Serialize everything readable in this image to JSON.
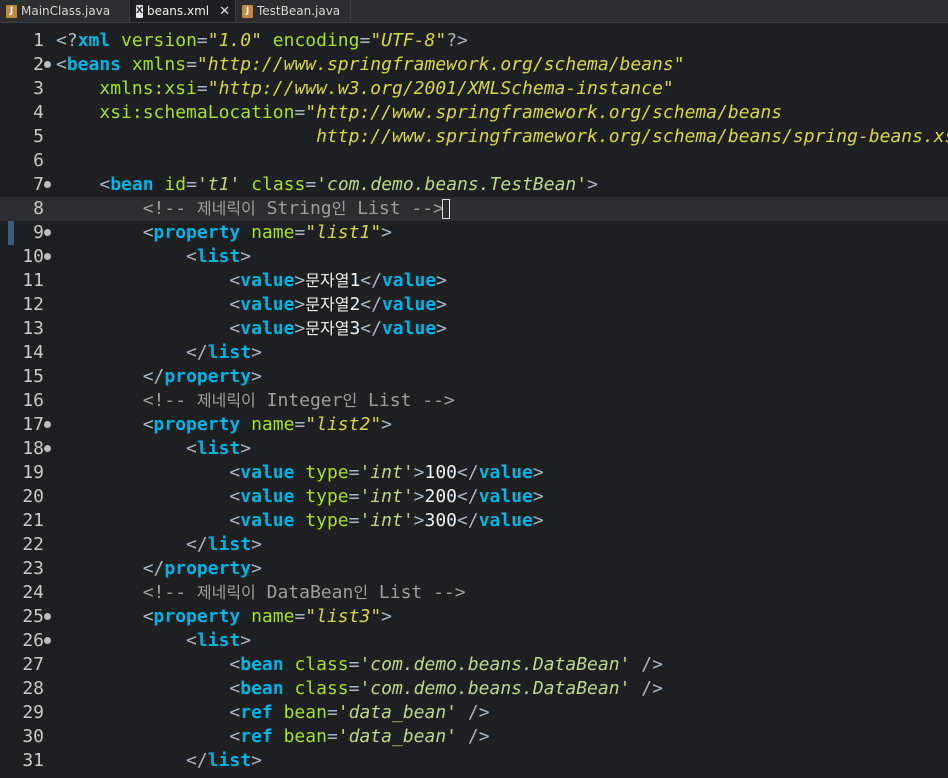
{
  "tabs": [
    {
      "label": "MainClass.java",
      "icon": "java-file-icon"
    },
    {
      "label": "beans.xml",
      "icon": "xml-file-icon",
      "active": true
    },
    {
      "label": "TestBean.java",
      "icon": "java-file-icon"
    }
  ],
  "lines": [
    {
      "n": "1",
      "html": "<span class='punct'>&lt;?</span><span class='tagn'>xml</span> <span class='attr'>version</span><span class='punct'>=</span><span class='str'>\"1.0\"</span> <span class='attr'>encoding</span><span class='punct'>=</span><span class='str'>\"UTF-8\"</span><span class='punct'>?&gt;</span>"
    },
    {
      "n": "2",
      "fold": true,
      "html": "<span class='punct'>&lt;</span><span class='tagn'>beans</span> <span class='attr'>xmlns</span><span class='punct'>=</span><span class='str'>\"http://www.springframework.org/schema/beans\"</span>"
    },
    {
      "n": "3",
      "html": "    <span class='attr'>xmlns:xsi</span><span class='punct'>=</span><span class='str'>\"http://www.w3.org/2001/XMLSchema-instance\"</span>"
    },
    {
      "n": "4",
      "html": "    <span class='attr'>xsi:schemaLocation</span><span class='punct'>=</span><span class='str'>\"http://www.springframework.org/schema/beans</span>"
    },
    {
      "n": "5",
      "html": "                        <span class='str'>http://www.springframework.org/schema/beans/spring-beans.xsd\"&gt;</span>"
    },
    {
      "n": "6",
      "html": ""
    },
    {
      "n": "7",
      "fold": true,
      "html": "    <span class='punct'>&lt;</span><span class='tagn'>bean</span> <span class='attr'>id</span><span class='punct'>=</span><span class='strp'>'t1'</span> <span class='attr'>class</span><span class='punct'>=</span><span class='strp'>'com.demo.beans.TestBean'</span><span class='punct'>&gt;</span>"
    },
    {
      "n": "8",
      "current": true,
      "html": "        <span class='comment'>&lt;!-- <span class='kor'>제네릭이</span> String<span class='kor'>인</span> List --&gt;</span><span class='cursor-box'></span>"
    },
    {
      "n": "9",
      "fold": true,
      "html": "        <span class='punct'>&lt;</span><span class='tagn'>property</span> <span class='attr'>name</span><span class='punct'>=</span><span class='str'>\"list1\"</span><span class='punct'>&gt;</span>"
    },
    {
      "n": "10",
      "fold": true,
      "html": "            <span class='punct'>&lt;</span><span class='tagn'>list</span><span class='punct'>&gt;</span>"
    },
    {
      "n": "11",
      "html": "                <span class='punct'>&lt;</span><span class='tagn'>value</span><span class='punct'>&gt;</span><span class='txt'><span class='kor'>문자열</span>1</span><span class='punct'>&lt;/</span><span class='tagn'>value</span><span class='punct'>&gt;</span>"
    },
    {
      "n": "12",
      "html": "                <span class='punct'>&lt;</span><span class='tagn'>value</span><span class='punct'>&gt;</span><span class='txt'><span class='kor'>문자열</span>2</span><span class='punct'>&lt;/</span><span class='tagn'>value</span><span class='punct'>&gt;</span>"
    },
    {
      "n": "13",
      "html": "                <span class='punct'>&lt;</span><span class='tagn'>value</span><span class='punct'>&gt;</span><span class='txt'><span class='kor'>문자열</span>3</span><span class='punct'>&lt;/</span><span class='tagn'>value</span><span class='punct'>&gt;</span>"
    },
    {
      "n": "14",
      "html": "            <span class='punct'>&lt;/</span><span class='tagn'>list</span><span class='punct'>&gt;</span>"
    },
    {
      "n": "15",
      "html": "        <span class='punct'>&lt;/</span><span class='tagn'>property</span><span class='punct'>&gt;</span>"
    },
    {
      "n": "16",
      "html": "        <span class='comment'>&lt;!-- <span class='kor'>제네릭이</span> Integer<span class='kor'>인</span> List --&gt;</span>"
    },
    {
      "n": "17",
      "fold": true,
      "html": "        <span class='punct'>&lt;</span><span class='tagn'>property</span> <span class='attr'>name</span><span class='punct'>=</span><span class='str'>\"list2\"</span><span class='punct'>&gt;</span>"
    },
    {
      "n": "18",
      "fold": true,
      "html": "            <span class='punct'>&lt;</span><span class='tagn'>list</span><span class='punct'>&gt;</span>"
    },
    {
      "n": "19",
      "html": "                <span class='punct'>&lt;</span><span class='tagn'>value</span> <span class='attr'>type</span><span class='punct'>=</span><span class='strp'>'int'</span><span class='punct'>&gt;</span><span class='txt'>100</span><span class='punct'>&lt;/</span><span class='tagn'>value</span><span class='punct'>&gt;</span>"
    },
    {
      "n": "20",
      "html": "                <span class='punct'>&lt;</span><span class='tagn'>value</span> <span class='attr'>type</span><span class='punct'>=</span><span class='strp'>'int'</span><span class='punct'>&gt;</span><span class='txt'>200</span><span class='punct'>&lt;/</span><span class='tagn'>value</span><span class='punct'>&gt;</span>"
    },
    {
      "n": "21",
      "html": "                <span class='punct'>&lt;</span><span class='tagn'>value</span> <span class='attr'>type</span><span class='punct'>=</span><span class='strp'>'int'</span><span class='punct'>&gt;</span><span class='txt'>300</span><span class='punct'>&lt;/</span><span class='tagn'>value</span><span class='punct'>&gt;</span>"
    },
    {
      "n": "22",
      "html": "            <span class='punct'>&lt;/</span><span class='tagn'>list</span><span class='punct'>&gt;</span>"
    },
    {
      "n": "23",
      "html": "        <span class='punct'>&lt;/</span><span class='tagn'>property</span><span class='punct'>&gt;</span>"
    },
    {
      "n": "24",
      "html": "        <span class='comment'>&lt;!-- <span class='kor'>제네릭이</span> DataBean<span class='kor'>인</span> List --&gt;</span>"
    },
    {
      "n": "25",
      "fold": true,
      "html": "        <span class='punct'>&lt;</span><span class='tagn'>property</span> <span class='attr'>name</span><span class='punct'>=</span><span class='str'>\"list3\"</span><span class='punct'>&gt;</span>"
    },
    {
      "n": "26",
      "fold": true,
      "html": "            <span class='punct'>&lt;</span><span class='tagn'>list</span><span class='punct'>&gt;</span>"
    },
    {
      "n": "27",
      "html": "                <span class='punct'>&lt;</span><span class='tagn'>bean</span> <span class='attr'>class</span><span class='punct'>=</span><span class='strp'>'com.demo.beans.DataBean'</span> <span class='punct'>/&gt;</span>"
    },
    {
      "n": "28",
      "html": "                <span class='punct'>&lt;</span><span class='tagn'>bean</span> <span class='attr'>class</span><span class='punct'>=</span><span class='strp'>'com.demo.beans.DataBean'</span> <span class='punct'>/&gt;</span>"
    },
    {
      "n": "29",
      "html": "                <span class='punct'>&lt;</span><span class='tagn'>ref</span> <span class='attr'>bean</span><span class='punct'>=</span><span class='strp'>'data_bean'</span> <span class='punct'>/&gt;</span>"
    },
    {
      "n": "30",
      "html": "                <span class='punct'>&lt;</span><span class='tagn'>ref</span> <span class='attr'>bean</span><span class='punct'>=</span><span class='strp'>'data_bean'</span> <span class='punct'>/&gt;</span>"
    },
    {
      "n": "31",
      "html": "            <span class='punct'>&lt;/</span><span class='tagn'>list</span><span class='punct'>&gt;</span>"
    }
  ]
}
